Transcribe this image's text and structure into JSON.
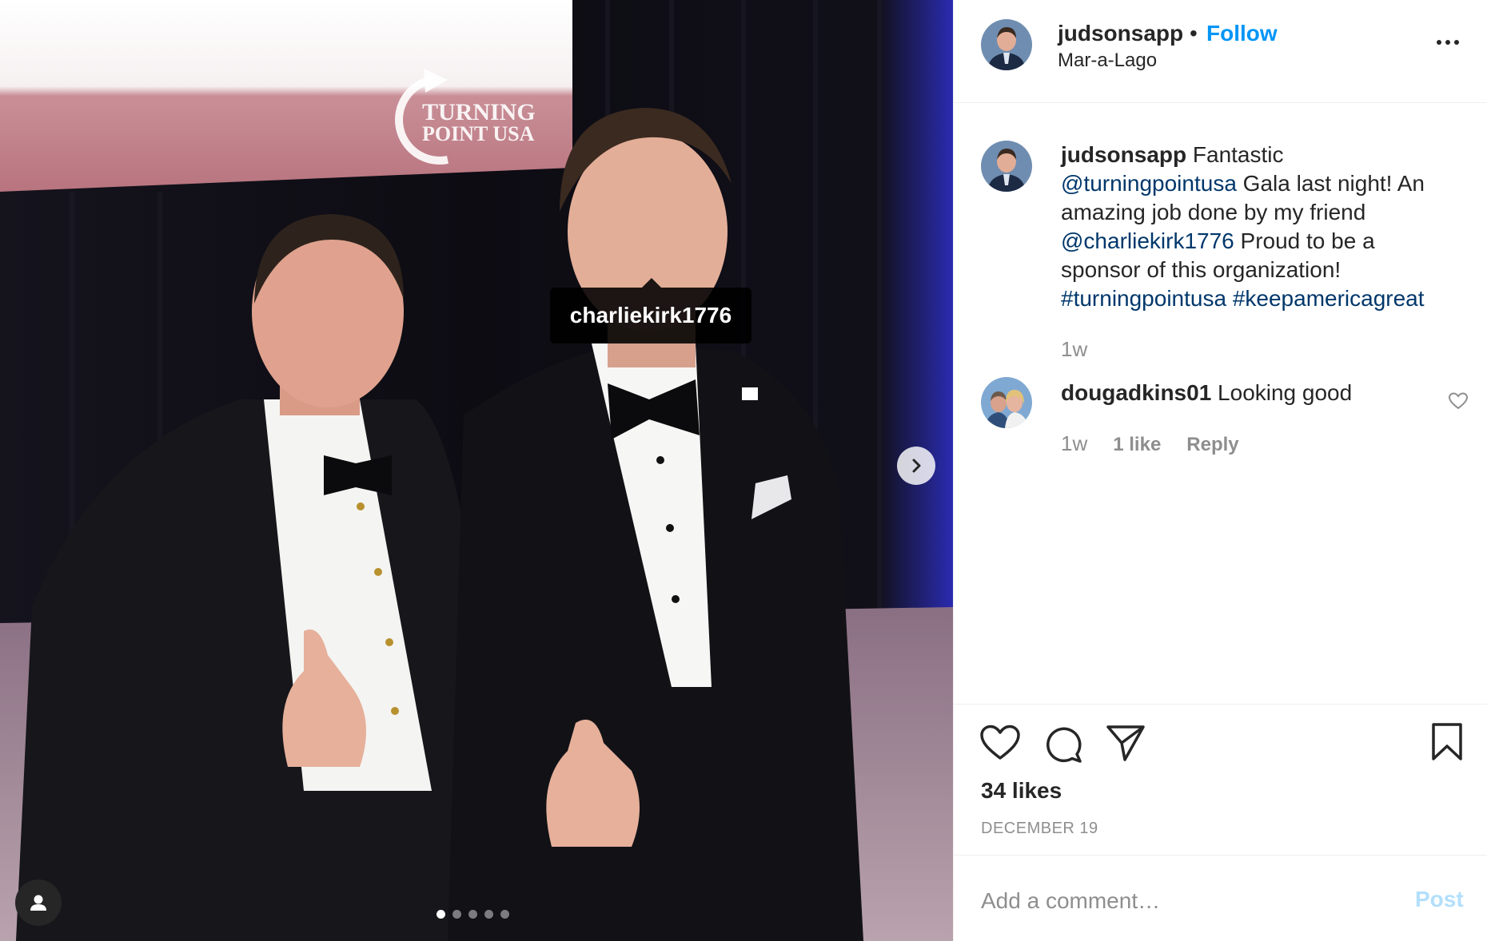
{
  "post": {
    "username": "judsonsapp",
    "separator": "•",
    "follow_label": "Follow",
    "location": "Mar-a-Lago"
  },
  "media": {
    "tagged_username": "charliekirk1776",
    "carousel_total": 5,
    "carousel_active": 1
  },
  "caption": {
    "username": "judsonsapp",
    "text_1": " Fantastic ",
    "mention_1": "@turningpointusa",
    "text_2": " Gala last night! An amazing job done by my friend ",
    "mention_2": "@charliekirk1776",
    "text_3": " Proud to be a sponsor of this organization! ",
    "hashtag_1": "#turningpointusa",
    "hashtag_2": "#keepamericagreat",
    "time": "1w"
  },
  "comments": [
    {
      "username": "dougadkins01",
      "text": " Looking good",
      "time": "1w",
      "likes": "1 like",
      "reply_label": "Reply"
    }
  ],
  "footer": {
    "likes": "34 likes",
    "date": "DECEMBER 19",
    "comment_placeholder": "Add a comment…",
    "post_label": "Post"
  },
  "icons": {
    "like": "heart-icon",
    "comment": "comment-icon",
    "share": "paper-plane-icon",
    "save": "bookmark-icon",
    "more": "more-options-icon",
    "next": "chevron-right-icon",
    "tags": "user-tag-icon"
  },
  "colors": {
    "accent": "#0095f6",
    "link": "#00376b",
    "muted": "#8e8e8e",
    "post_disabled": "#b2dffc"
  }
}
